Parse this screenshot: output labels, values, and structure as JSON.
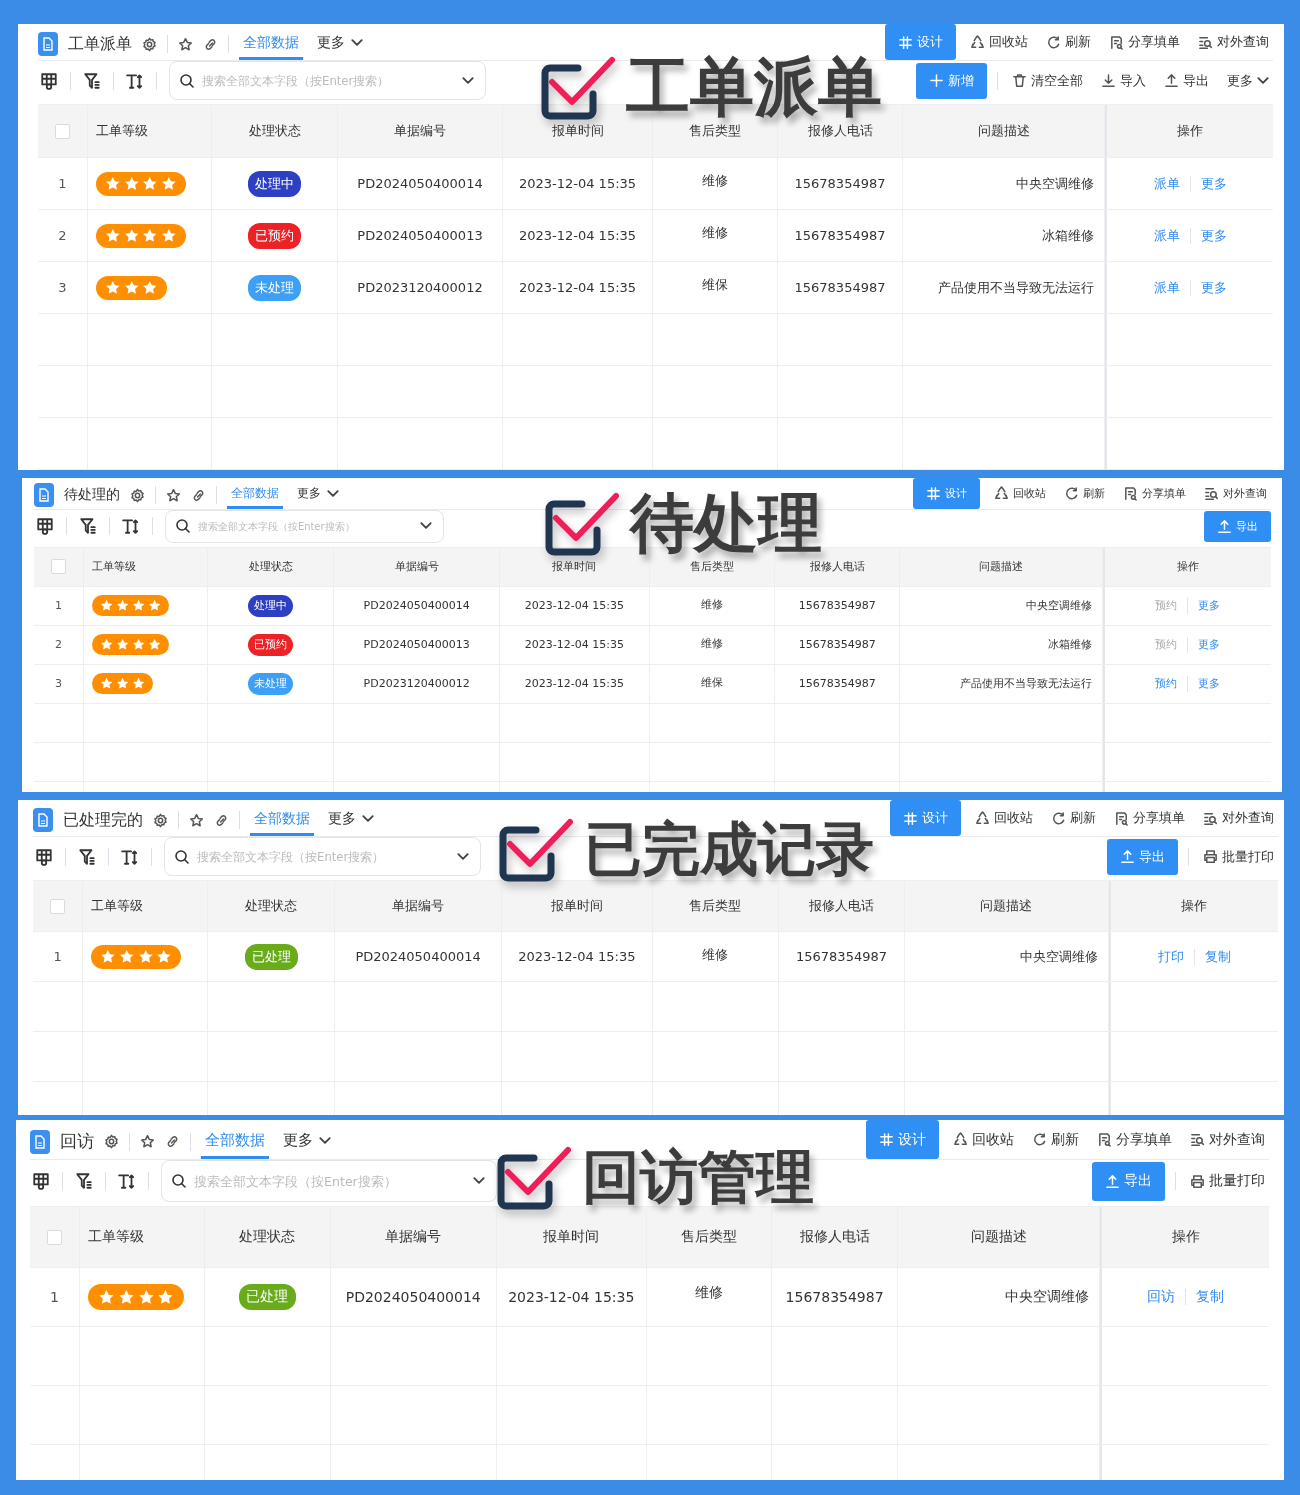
{
  "panels": [
    {
      "title": "工单派单",
      "tabs": [
        {
          "label": "全部数据",
          "selected": true
        },
        {
          "label": "更多",
          "selected": false
        }
      ],
      "top_actions": [
        {
          "label": "设计",
          "kind": "design"
        },
        {
          "label": "回收站",
          "kind": "recycle"
        },
        {
          "label": "刷新",
          "kind": "refresh"
        },
        {
          "label": "分享填单",
          "kind": "share"
        },
        {
          "label": "对外查询",
          "kind": "query"
        }
      ],
      "search": {
        "placeholder": "搜索全部文本字段（按Enter搜索）"
      },
      "select_all": {
        "checked": false
      },
      "right_actions": [
        {
          "label": "新增",
          "kind": "add"
        },
        {
          "label": "清空全部",
          "kind": "trash"
        },
        {
          "label": "导入",
          "kind": "import"
        },
        {
          "label": "导出",
          "kind": "export"
        },
        {
          "label": "更多",
          "kind": "more"
        }
      ],
      "columns": [
        "工单等级",
        "处理状态",
        "单据编号",
        "报单时间",
        "售后类型",
        "报修人电话",
        "问题描述",
        "操作"
      ],
      "rows": [
        {
          "index": "1",
          "stars": 4,
          "status": {
            "text": "处理中",
            "color": "#2d3fc2"
          },
          "number": "PD2024050400014",
          "time": "2023-12-04 15:35",
          "type": "维修",
          "phone": "15678354987",
          "problem": "中央空调维修",
          "actions": [
            {
              "label": "派单",
              "disabled": false
            },
            {
              "label": "更多",
              "disabled": false
            }
          ]
        },
        {
          "index": "2",
          "stars": 4,
          "status": {
            "text": "已预约",
            "color": "#ec2227"
          },
          "number": "PD2024050400013",
          "time": "2023-12-04 15:35",
          "type": "维修",
          "phone": "15678354987",
          "problem": "冰箱维修",
          "actions": [
            {
              "label": "派单",
              "disabled": false
            },
            {
              "label": "更多",
              "disabled": false
            }
          ]
        },
        {
          "index": "3",
          "stars": 3,
          "status": {
            "text": "未处理",
            "color": "#3d9ff5"
          },
          "number": "PD2023120400012",
          "time": "2023-12-04 15:35",
          "type": "维保",
          "phone": "15678354987",
          "problem": "产品使用不当导致无法运行",
          "actions": [
            {
              "label": "派单",
              "disabled": false
            },
            {
              "label": "更多",
              "disabled": false
            }
          ]
        }
      ],
      "banner": "工单派单"
    },
    {
      "title": "待处理的",
      "tabs": [
        {
          "label": "全部数据",
          "selected": true
        },
        {
          "label": "更多",
          "selected": false
        }
      ],
      "top_actions": [
        {
          "label": "设计",
          "kind": "design"
        },
        {
          "label": "回收站",
          "kind": "recycle"
        },
        {
          "label": "刷新",
          "kind": "refresh"
        },
        {
          "label": "分享填单",
          "kind": "share"
        },
        {
          "label": "对外查询",
          "kind": "query"
        }
      ],
      "search": {
        "placeholder": "搜索全部文本字段（按Enter搜索）"
      },
      "select_all": {
        "checked": false
      },
      "right_actions": [
        {
          "label": "导出",
          "kind": "exportbtn"
        }
      ],
      "columns": [
        "工单等级",
        "处理状态",
        "单据编号",
        "报单时间",
        "售后类型",
        "报修人电话",
        "问题描述",
        "操作"
      ],
      "rows": [
        {
          "index": "1",
          "stars": 4,
          "status": {
            "text": "处理中",
            "color": "#2d3fc2"
          },
          "number": "PD2024050400014",
          "time": "2023-12-04 15:35",
          "type": "维修",
          "phone": "15678354987",
          "problem": "中央空调维修",
          "actions": [
            {
              "label": "预约",
              "disabled": true
            },
            {
              "label": "更多",
              "disabled": false
            }
          ]
        },
        {
          "index": "2",
          "stars": 4,
          "status": {
            "text": "已预约",
            "color": "#ec2227"
          },
          "number": "PD2024050400013",
          "time": "2023-12-04 15:35",
          "type": "维修",
          "phone": "15678354987",
          "problem": "冰箱维修",
          "actions": [
            {
              "label": "预约",
              "disabled": true
            },
            {
              "label": "更多",
              "disabled": false
            }
          ]
        },
        {
          "index": "3",
          "stars": 3,
          "status": {
            "text": "未处理",
            "color": "#3d9ff5"
          },
          "number": "PD2023120400012",
          "time": "2023-12-04 15:35",
          "type": "维保",
          "phone": "15678354987",
          "problem": "产品使用不当导致无法运行",
          "actions": [
            {
              "label": "预约",
              "disabled": false
            },
            {
              "label": "更多",
              "disabled": false
            }
          ]
        }
      ],
      "banner": "待处理"
    },
    {
      "title": "已处理完的",
      "tabs": [
        {
          "label": "全部数据",
          "selected": true
        },
        {
          "label": "更多",
          "selected": false
        }
      ],
      "top_actions": [
        {
          "label": "设计",
          "kind": "design"
        },
        {
          "label": "回收站",
          "kind": "recycle"
        },
        {
          "label": "刷新",
          "kind": "refresh"
        },
        {
          "label": "分享填单",
          "kind": "share"
        },
        {
          "label": "对外查询",
          "kind": "query"
        }
      ],
      "search": {
        "placeholder": "搜索全部文本字段（按Enter搜索）"
      },
      "select_all": {
        "checked": false
      },
      "right_actions": [
        {
          "label": "导出",
          "kind": "exportbtn"
        },
        {
          "label": "批量打印",
          "kind": "print"
        }
      ],
      "columns": [
        "工单等级",
        "处理状态",
        "单据编号",
        "报单时间",
        "售后类型",
        "报修人电话",
        "问题描述",
        "操作"
      ],
      "rows": [
        {
          "index": "1",
          "stars": 4,
          "status": {
            "text": "已处理",
            "color": "#6aab1c"
          },
          "number": "PD2024050400014",
          "time": "2023-12-04 15:35",
          "type": "维修",
          "phone": "15678354987",
          "problem": "中央空调维修",
          "actions": [
            {
              "label": "打印",
              "disabled": false
            },
            {
              "label": "复制",
              "disabled": false
            }
          ]
        }
      ],
      "banner": "已完成记录"
    },
    {
      "title": "回访",
      "tabs": [
        {
          "label": "全部数据",
          "selected": true
        },
        {
          "label": "更多",
          "selected": false
        }
      ],
      "top_actions": [
        {
          "label": "设计",
          "kind": "design"
        },
        {
          "label": "回收站",
          "kind": "recycle"
        },
        {
          "label": "刷新",
          "kind": "refresh"
        },
        {
          "label": "分享填单",
          "kind": "share"
        },
        {
          "label": "对外查询",
          "kind": "query"
        }
      ],
      "search": {
        "placeholder": "搜索全部文本字段（按Enter搜索）"
      },
      "select_all": {
        "checked": false
      },
      "right_actions": [
        {
          "label": "导出",
          "kind": "exportbtn"
        },
        {
          "label": "批量打印",
          "kind": "print"
        }
      ],
      "columns": [
        "工单等级",
        "处理状态",
        "单据编号",
        "报单时间",
        "售后类型",
        "报修人电话",
        "问题描述",
        "操作"
      ],
      "rows": [
        {
          "index": "1",
          "stars": 4,
          "status": {
            "text": "已处理",
            "color": "#6aab1c"
          },
          "number": "PD2024050400014",
          "time": "2023-12-04 15:35",
          "type": "维修",
          "phone": "15678354987",
          "problem": "中央空调维修",
          "actions": [
            {
              "label": "回访",
              "disabled": false
            },
            {
              "label": "复制",
              "disabled": false
            }
          ]
        }
      ],
      "banner": "回访管理"
    }
  ]
}
